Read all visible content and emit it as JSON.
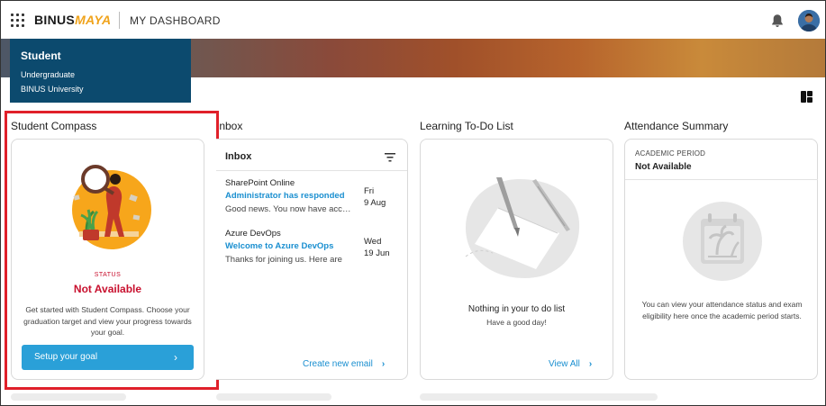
{
  "header": {
    "logo_main": "BINUS",
    "logo_accent": "MAYA",
    "title": "MY DASHBOARD",
    "icons": [
      "apps-grid-icon",
      "bell-icon",
      "avatar"
    ]
  },
  "profile": {
    "role": "Student",
    "level": "Undergraduate",
    "institution": "BINUS University"
  },
  "compass": {
    "section_title": "Student Compass",
    "status_label": "STATUS",
    "status_value": "Not Available",
    "description": "Get started with Student Compass. Choose your graduation target and view your progress towards your goal.",
    "button_label": "Setup your goal",
    "chevron": "›"
  },
  "inbox": {
    "section_title": "Inbox",
    "card_title": "Inbox",
    "messages": [
      {
        "source": "SharePoint Online",
        "subject": "Administrator has responded",
        "preview": "Good news. You now have access",
        "day": "Fri",
        "date": "9 Aug"
      },
      {
        "source": "Azure DevOps",
        "subject": "Welcome to Azure DevOps",
        "preview": "Thanks for joining us. Here are",
        "day": "Wed",
        "date": "19 Jun"
      }
    ],
    "link_label": "Create new email",
    "chevron": "›"
  },
  "todo": {
    "section_title": "Learning To-Do List",
    "empty_title": "Nothing in your to do list",
    "empty_subtitle": "Have a good day!",
    "link_label": "View All",
    "chevron": "›"
  },
  "attendance": {
    "section_title": "Attendance Summary",
    "period_label": "ACADEMIC PERIOD",
    "period_value": "Not Available",
    "description": "You can view your attendance status and exam eligibility here once the academic period starts."
  },
  "colors": {
    "accent_blue": "#2aa0d8",
    "status_red": "#c8102e",
    "profile_navy": "#0c4a6e",
    "highlight_red": "#e0202a"
  }
}
